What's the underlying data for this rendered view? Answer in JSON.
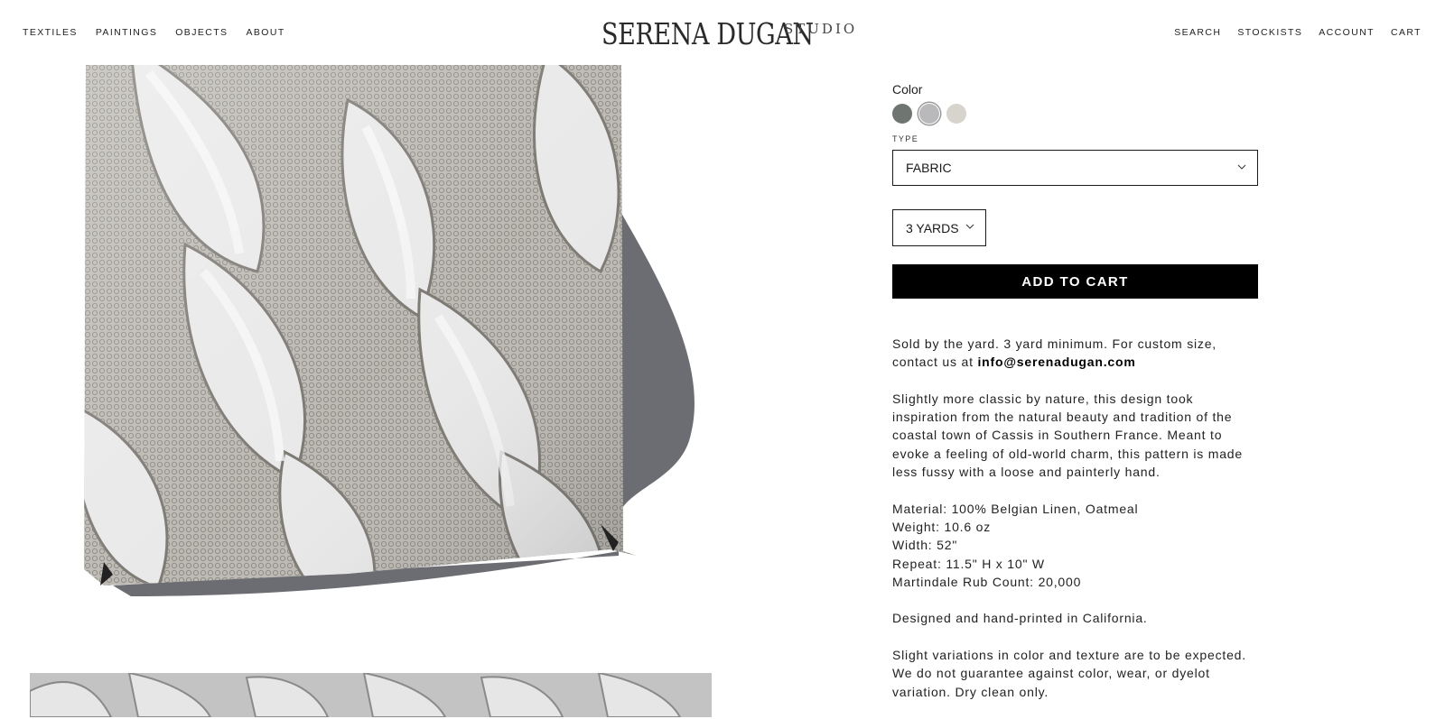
{
  "nav": {
    "left": [
      "TEXTILES",
      "PAINTINGS",
      "OBJECTS",
      "ABOUT"
    ],
    "right": [
      "SEARCH",
      "STOCKISTS",
      "ACCOUNT",
      "CART"
    ]
  },
  "logo": {
    "main": "SERENA DUGAN",
    "sub": "STUDIO"
  },
  "product": {
    "color_label": "Color",
    "swatches": [
      {
        "name": "charcoal",
        "color": "#6f7571",
        "selected": false
      },
      {
        "name": "grey",
        "color": "#b9b9bb",
        "selected": true
      },
      {
        "name": "oatmeal",
        "color": "#d6d4cc",
        "selected": false
      }
    ],
    "type_label": "TYPE",
    "type_value": "FABRIC",
    "qty_value": "3 YARDS",
    "add_to_cart": "ADD TO CART",
    "desc": {
      "p1_text": "Sold by the yard. 3 yard minimum. For custom size, contact us at ",
      "p1_email": "info@serenadugan.com",
      "p2": "Slightly more classic by nature, this design took inspiration from the natural beauty and tradition of the coastal town of Cassis in Southern France. Meant to evoke a feeling of old-world charm, this pattern is made less fussy with a loose and painterly hand.",
      "spec1": "Material: 100% Belgian Linen, Oatmeal",
      "spec2": "Weight: 10.6 oz",
      "spec3": "Width: 52\"",
      "spec4": "Repeat: 11.5\" H x 10\" W",
      "spec5": "Martindale Rub Count: 20,000",
      "p4": "Designed and hand-printed in California.",
      "p5": "Slight variations in color and texture are to be expected. We do not guarantee against color, wear, or dyelot variation. Dry clean only."
    }
  }
}
